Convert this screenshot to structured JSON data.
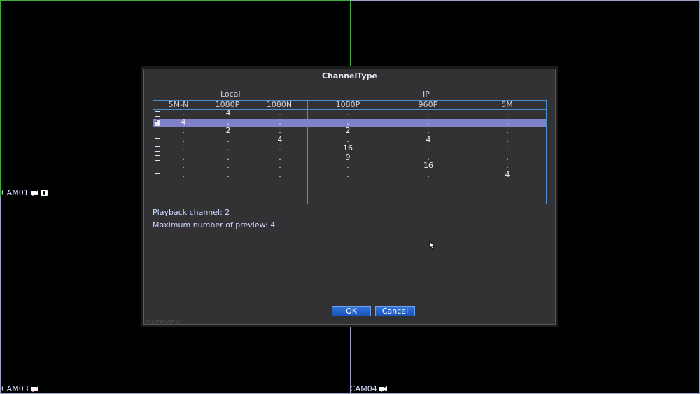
{
  "cameras": [
    {
      "label": "CAM01"
    },
    {
      "label": "CAM03"
    },
    {
      "label": "CAM04"
    }
  ],
  "dialog": {
    "title": "ChannelType",
    "groups": {
      "local": "Local",
      "ip": "IP"
    },
    "columns": [
      "5M-N",
      "1080P",
      "1080N",
      "1080P",
      "960P",
      "5M"
    ],
    "rows": [
      {
        "checked": false,
        "selected": false,
        "values": [
          ".",
          "4",
          ".",
          ".",
          ".",
          "."
        ]
      },
      {
        "checked": true,
        "selected": true,
        "values": [
          "4",
          ".",
          ".",
          ".",
          ".",
          "."
        ]
      },
      {
        "checked": false,
        "selected": false,
        "values": [
          ".",
          "2",
          ".",
          "2",
          ".",
          "."
        ]
      },
      {
        "checked": false,
        "selected": false,
        "values": [
          ".",
          ".",
          "4",
          ".",
          "4",
          "."
        ]
      },
      {
        "checked": false,
        "selected": false,
        "values": [
          ".",
          ".",
          ".",
          "16",
          ".",
          "."
        ]
      },
      {
        "checked": false,
        "selected": false,
        "values": [
          ".",
          ".",
          ".",
          "9",
          ".",
          "."
        ]
      },
      {
        "checked": false,
        "selected": false,
        "values": [
          ".",
          ".",
          ".",
          ".",
          "16",
          "."
        ]
      },
      {
        "checked": false,
        "selected": false,
        "values": [
          ".",
          ".",
          ".",
          ".",
          ".",
          "4"
        ]
      }
    ],
    "playback_channel": "Playback channel: 2",
    "max_preview": "Maximum number of preview: 4",
    "ok_label": "OK",
    "cancel_label": "Cancel",
    "watermark": "SAFEVIEW"
  },
  "colors": {
    "accent": "#2f74e0",
    "selected_row": "#7f82c8",
    "grid_line": "#4a8fd0"
  }
}
